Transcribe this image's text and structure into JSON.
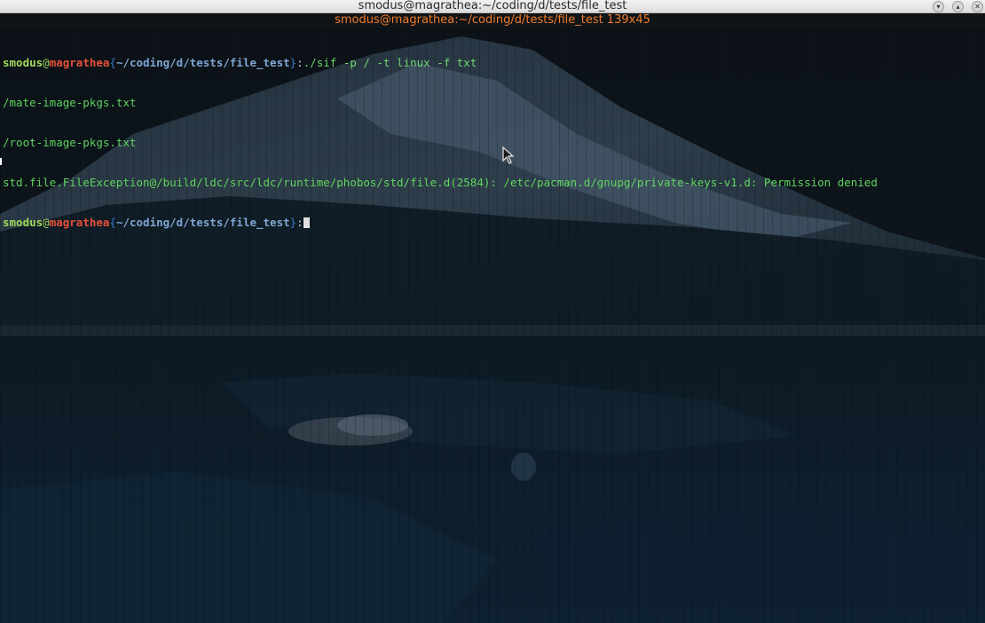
{
  "window": {
    "title": "smodus@magrathea:~/coding/d/tests/file_test",
    "controls": [
      "chevron-down-icon",
      "chevron-up-icon",
      "close-icon"
    ]
  },
  "tab": {
    "title": "smodus@magrathea:~/coding/d/tests/file_test 139x45"
  },
  "terminal": {
    "prompt": {
      "user": "smodus",
      "at": "@",
      "host": "magrathea",
      "open_brace": "{",
      "path": "~/coding/d/tests/file_test",
      "close_brace": "}",
      "colon": ":"
    },
    "command": "./sif -p / -t linux -f txt",
    "output": [
      "/mate-image-pkgs.txt",
      "/root-image-pkgs.txt",
      "std.file.FileException@/build/ldc/src/ldc/runtime/phobos/std/file.d(2584): /etc/pacman.d/gnupg/private-keys-v1.d: Permission denied"
    ]
  },
  "colors": {
    "user": "#a0d85a",
    "host": "#e8503a",
    "path": "#7fa5d2",
    "output": "#5fd55f",
    "tab_title": "#f07a2a"
  }
}
